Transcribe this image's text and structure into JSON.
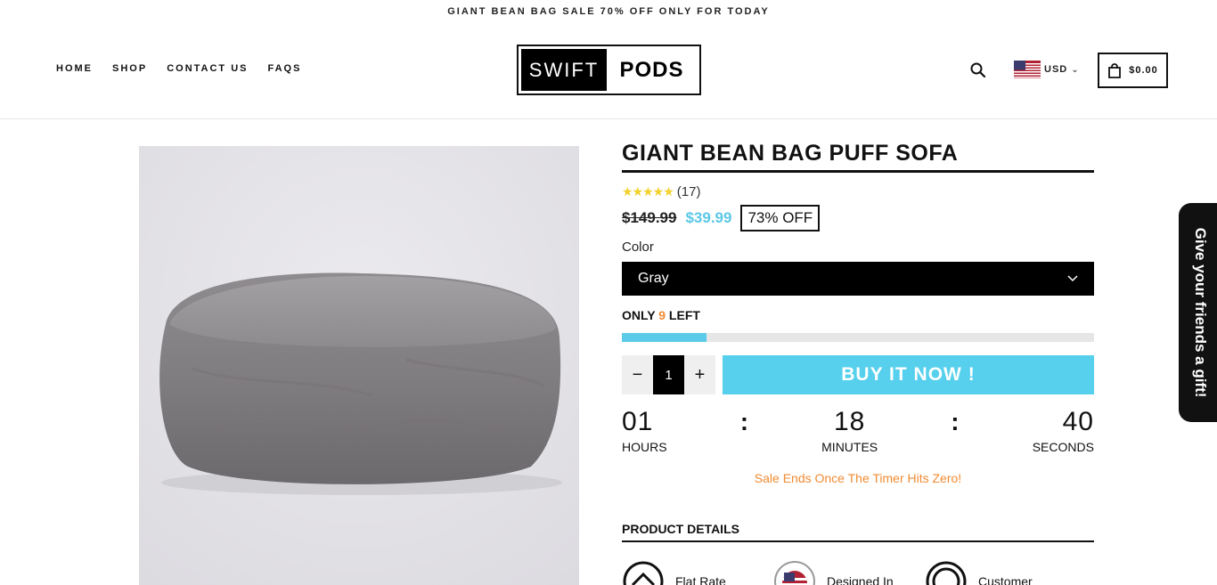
{
  "announcement": "GIANT BEAN BAG SALE 70% OFF ONLY FOR TODAY",
  "nav": {
    "home": "HOME",
    "shop": "SHOP",
    "contact": "CONTACT US",
    "faqs": "FAQS"
  },
  "logo": {
    "part1": "SWIFT",
    "part2": "PODS"
  },
  "header": {
    "search_icon": "search-icon",
    "currency": "USD",
    "flag_icon": "us-flag-icon",
    "cart_icon": "shopping-bag-icon",
    "cart_total": "$0.00"
  },
  "product": {
    "title": "GIANT BEAN BAG PUFF SOFA",
    "rating_stars": 5,
    "review_count": "(17)",
    "old_price": "$149.99",
    "new_price": "$39.99",
    "discount": "73% OFF",
    "color_label": "Color",
    "color_value": "Gray",
    "stock_prefix": "ONLY ",
    "stock_count": "9",
    "stock_suffix": " LEFT",
    "stock_fraction": 0.18,
    "quantity": "1",
    "buy_label": "BUY IT NOW !"
  },
  "timer": {
    "hours": "01",
    "hours_label": "HOURS",
    "minutes": "18",
    "minutes_label": "MINUTES",
    "seconds": "40",
    "seconds_label": "SECONDS",
    "separator": ":",
    "note": "Sale Ends Once The Timer Hits Zero!"
  },
  "details": {
    "title": "PRODUCT DETAILS",
    "features": [
      "Flat Rate",
      "Designed In",
      "Customer"
    ]
  },
  "gift_tab": "Give your friends a gift!",
  "colors": {
    "accent_blue": "#56d0ec",
    "price_blue": "#5bc8e6",
    "orange": "#f08b32",
    "star_yellow": "#f2d12b"
  }
}
